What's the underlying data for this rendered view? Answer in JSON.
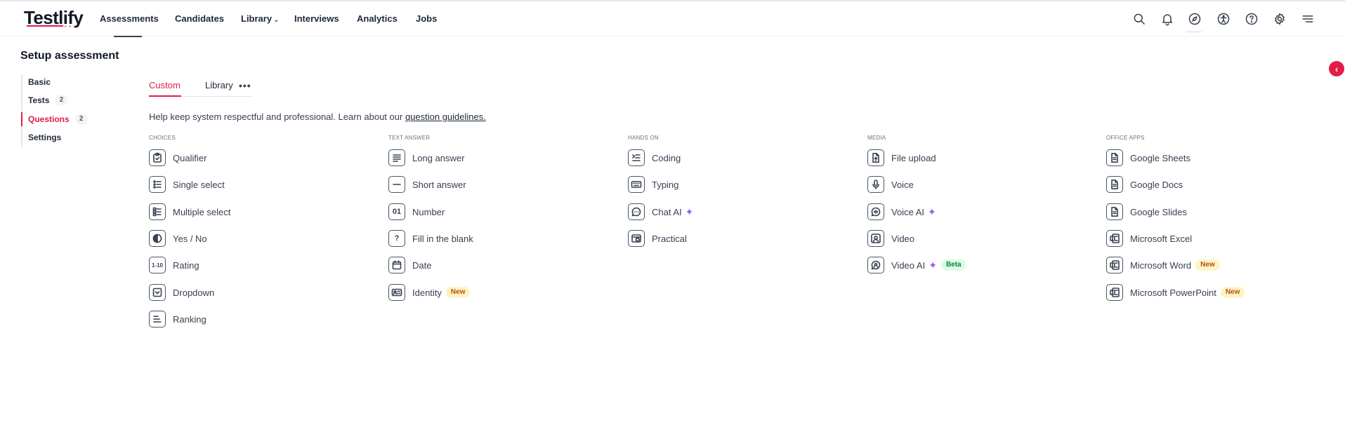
{
  "logo": {
    "text": "Testlify"
  },
  "nav": {
    "items": [
      {
        "label": "Assessments",
        "active": true
      },
      {
        "label": "Candidates"
      },
      {
        "label": "Library",
        "dropdown": true
      },
      {
        "label": "Interviews"
      },
      {
        "label": "Analytics"
      },
      {
        "label": "Jobs"
      }
    ],
    "icons": [
      "search-icon",
      "bell-icon",
      "compass-icon",
      "accessibility-icon",
      "help-icon",
      "settings-icon",
      "menu-icon"
    ]
  },
  "page": {
    "title": "Setup assessment"
  },
  "sidebar": {
    "items": [
      {
        "label": "Basic"
      },
      {
        "label": "Tests",
        "count": "2"
      },
      {
        "label": "Questions",
        "count": "2",
        "active": true
      },
      {
        "label": "Settings"
      }
    ]
  },
  "tabs": [
    {
      "label": "Custom",
      "active": true
    },
    {
      "label": "Library"
    }
  ],
  "help": {
    "text": "Help keep system respectful and professional. Learn about our ",
    "link": "question guidelines."
  },
  "categories": [
    {
      "label": "CHOICES",
      "items": [
        {
          "label": "Qualifier",
          "icon": "clipboard-check-icon"
        },
        {
          "label": "Single select",
          "icon": "list-single-icon"
        },
        {
          "label": "Multiple select",
          "icon": "list-multiple-icon"
        },
        {
          "label": "Yes / No",
          "icon": "half-circle-icon"
        },
        {
          "label": "Rating",
          "icon": "rating-scale-icon",
          "glyph": "1-10"
        },
        {
          "label": "Dropdown",
          "icon": "dropdown-icon"
        },
        {
          "label": "Ranking",
          "icon": "ranking-icon"
        }
      ]
    },
    {
      "label": "TEXT ANSWER",
      "items": [
        {
          "label": "Long answer",
          "icon": "paragraph-icon"
        },
        {
          "label": "Short answer",
          "icon": "short-line-icon"
        },
        {
          "label": "Number",
          "icon": "number-icon",
          "glyph": "01"
        },
        {
          "label": "Fill in the blank",
          "icon": "question-blank-icon",
          "glyph": "?"
        },
        {
          "label": "Date",
          "icon": "calendar-icon"
        },
        {
          "label": "Identity",
          "icon": "id-card-icon",
          "badge": "New"
        }
      ]
    },
    {
      "label": "HANDS ON",
      "items": [
        {
          "label": "Coding",
          "icon": "code-icon"
        },
        {
          "label": "Typing",
          "icon": "keyboard-icon"
        },
        {
          "label": "Chat AI",
          "icon": "chat-icon",
          "ai": true
        },
        {
          "label": "Practical",
          "icon": "practical-icon"
        }
      ]
    },
    {
      "label": "MEDIA",
      "items": [
        {
          "label": "File upload",
          "icon": "file-upload-icon"
        },
        {
          "label": "Voice",
          "icon": "microphone-icon"
        },
        {
          "label": "Voice AI",
          "icon": "voice-ai-icon",
          "ai": true
        },
        {
          "label": "Video",
          "icon": "video-icon"
        },
        {
          "label": "Video AI",
          "icon": "video-ai-icon",
          "ai": true,
          "badge": "Beta"
        }
      ]
    },
    {
      "label": "OFFICE APPS",
      "items": [
        {
          "label": "Google Sheets",
          "icon": "doc-icon"
        },
        {
          "label": "Google Docs",
          "icon": "doc-icon"
        },
        {
          "label": "Google Slides",
          "icon": "doc-icon"
        },
        {
          "label": "Microsoft Excel",
          "icon": "office-icon"
        },
        {
          "label": "Microsoft Word",
          "icon": "office-icon",
          "badge": "New"
        },
        {
          "label": "Microsoft PowerPoint",
          "icon": "office-icon",
          "badge": "New"
        }
      ]
    }
  ],
  "colors": {
    "accent": "#e11d48",
    "ai_sparkle": "#8b5cf6",
    "new_badge_bg": "#fef3c7",
    "beta_badge_bg": "#dcfce7"
  }
}
